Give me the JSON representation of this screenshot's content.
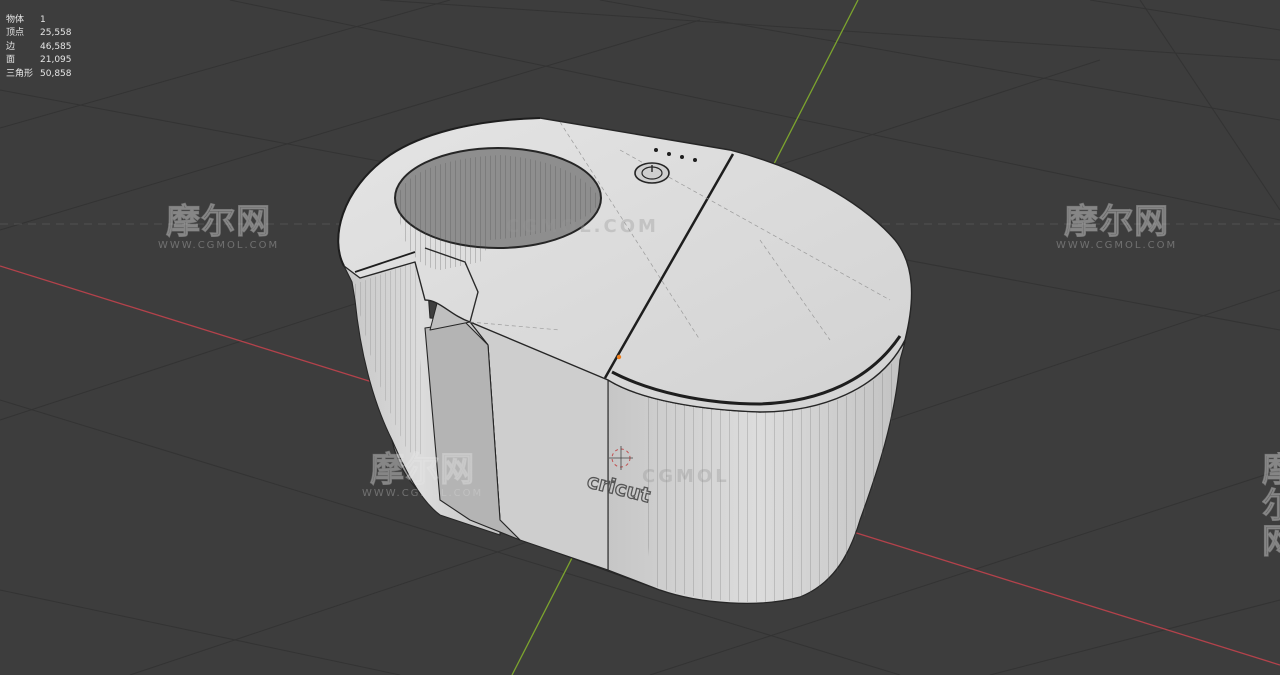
{
  "stats": [
    {
      "label": "物体",
      "value": "1"
    },
    {
      "label": "顶点",
      "value": "25,558"
    },
    {
      "label": "边",
      "value": "46,585"
    },
    {
      "label": "面",
      "value": "21,095"
    },
    {
      "label": "三角形",
      "value": "50,858"
    }
  ],
  "model": {
    "logo_text": "cricut",
    "icon": "power-icon"
  },
  "watermark": {
    "logo": "摩尔网",
    "url": "WWW.CGMOL.COM",
    "center_text": "CGMOL.COM",
    "lower_text": "CGMOL"
  },
  "colors": {
    "viewport_bg": "#3d3d3d",
    "grid_line": "#333333",
    "x_axis": "#b3424b",
    "y_axis": "#7ca42e",
    "model_face": "#d6d6d6",
    "wire": "#2a2a2a",
    "selection_origin": "#f07f1c"
  }
}
